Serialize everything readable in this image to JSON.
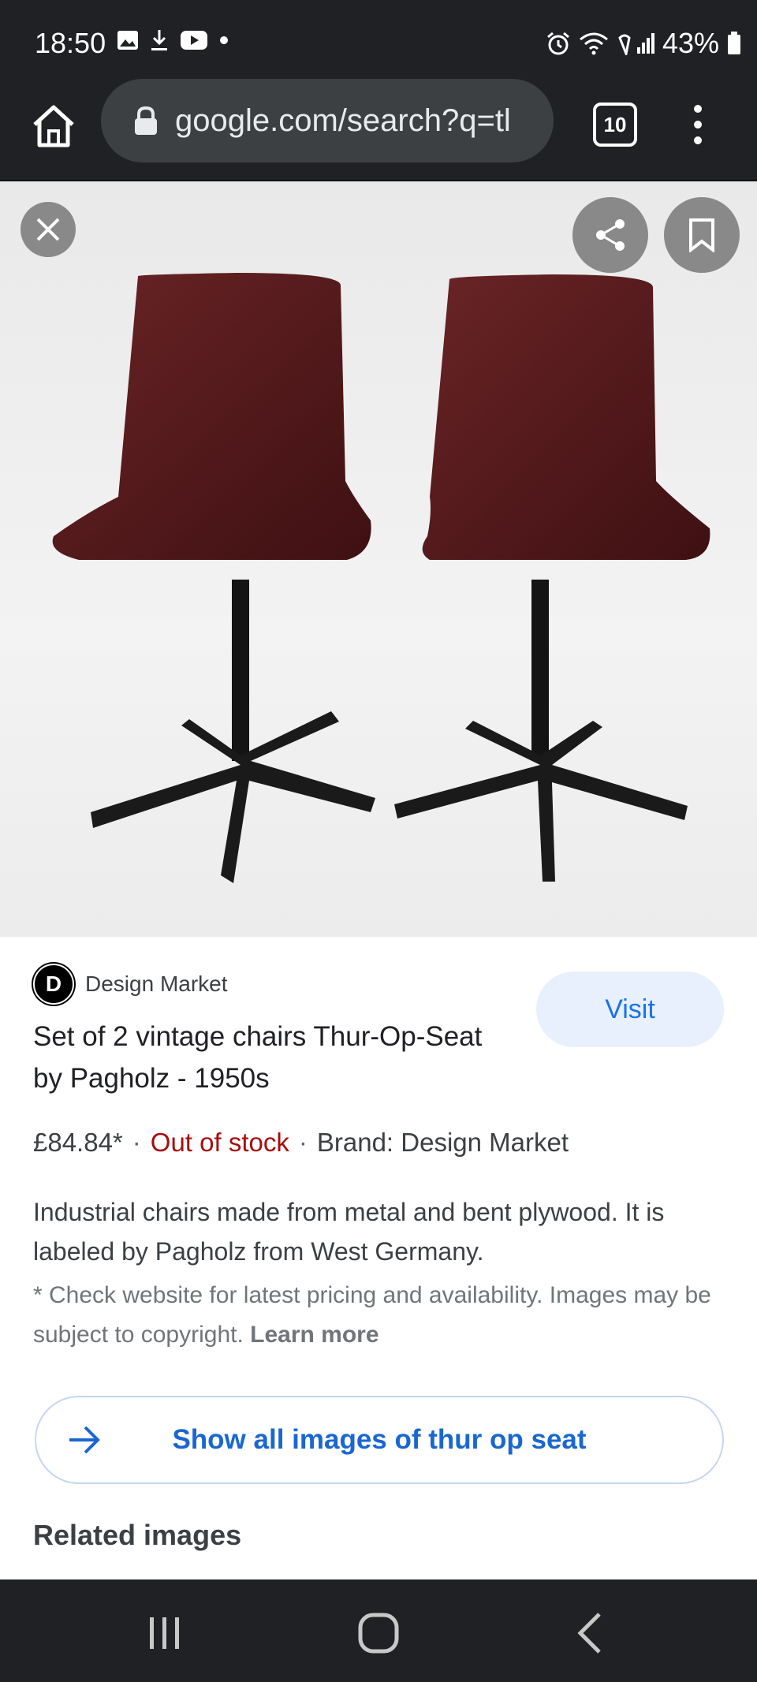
{
  "status_bar": {
    "time": "18:50",
    "battery": "43%"
  },
  "browser": {
    "url": "google.com/search?q=tl",
    "tab_count": "10"
  },
  "source": {
    "logo_letter": "D",
    "name": "Design Market"
  },
  "visit_button": "Visit",
  "product": {
    "title": "Set of 2 vintage chairs Thur-Op-Seat by Pagholz - 1950s",
    "price": "£84.84*",
    "stock": "Out of stock",
    "brand": "Brand: Design Market",
    "description": "Industrial chairs made from metal and bent plywood. It is labeled by Pagholz from West Germany.",
    "disclaimer": "* Check website for latest pricing and availability. Images may be subject to copyright.",
    "learn_more": "Learn more"
  },
  "show_all_button": "Show all images of thur op seat",
  "related_images_title": "Related images",
  "colors": {
    "bar_bg": "#202124",
    "link_blue": "#1967d2",
    "stock_red": "#a50e0e",
    "chair_wood": "#5a1a1c"
  },
  "icons": [
    "image-icon",
    "download-icon",
    "youtube-icon",
    "alarm-icon",
    "wifi-icon",
    "signal-icon",
    "battery-icon",
    "home-icon",
    "lock-icon",
    "menu-icon",
    "close-icon",
    "share-icon",
    "bookmark-icon",
    "arrow-right-icon",
    "recent-apps-icon",
    "nav-home-icon",
    "back-icon"
  ]
}
